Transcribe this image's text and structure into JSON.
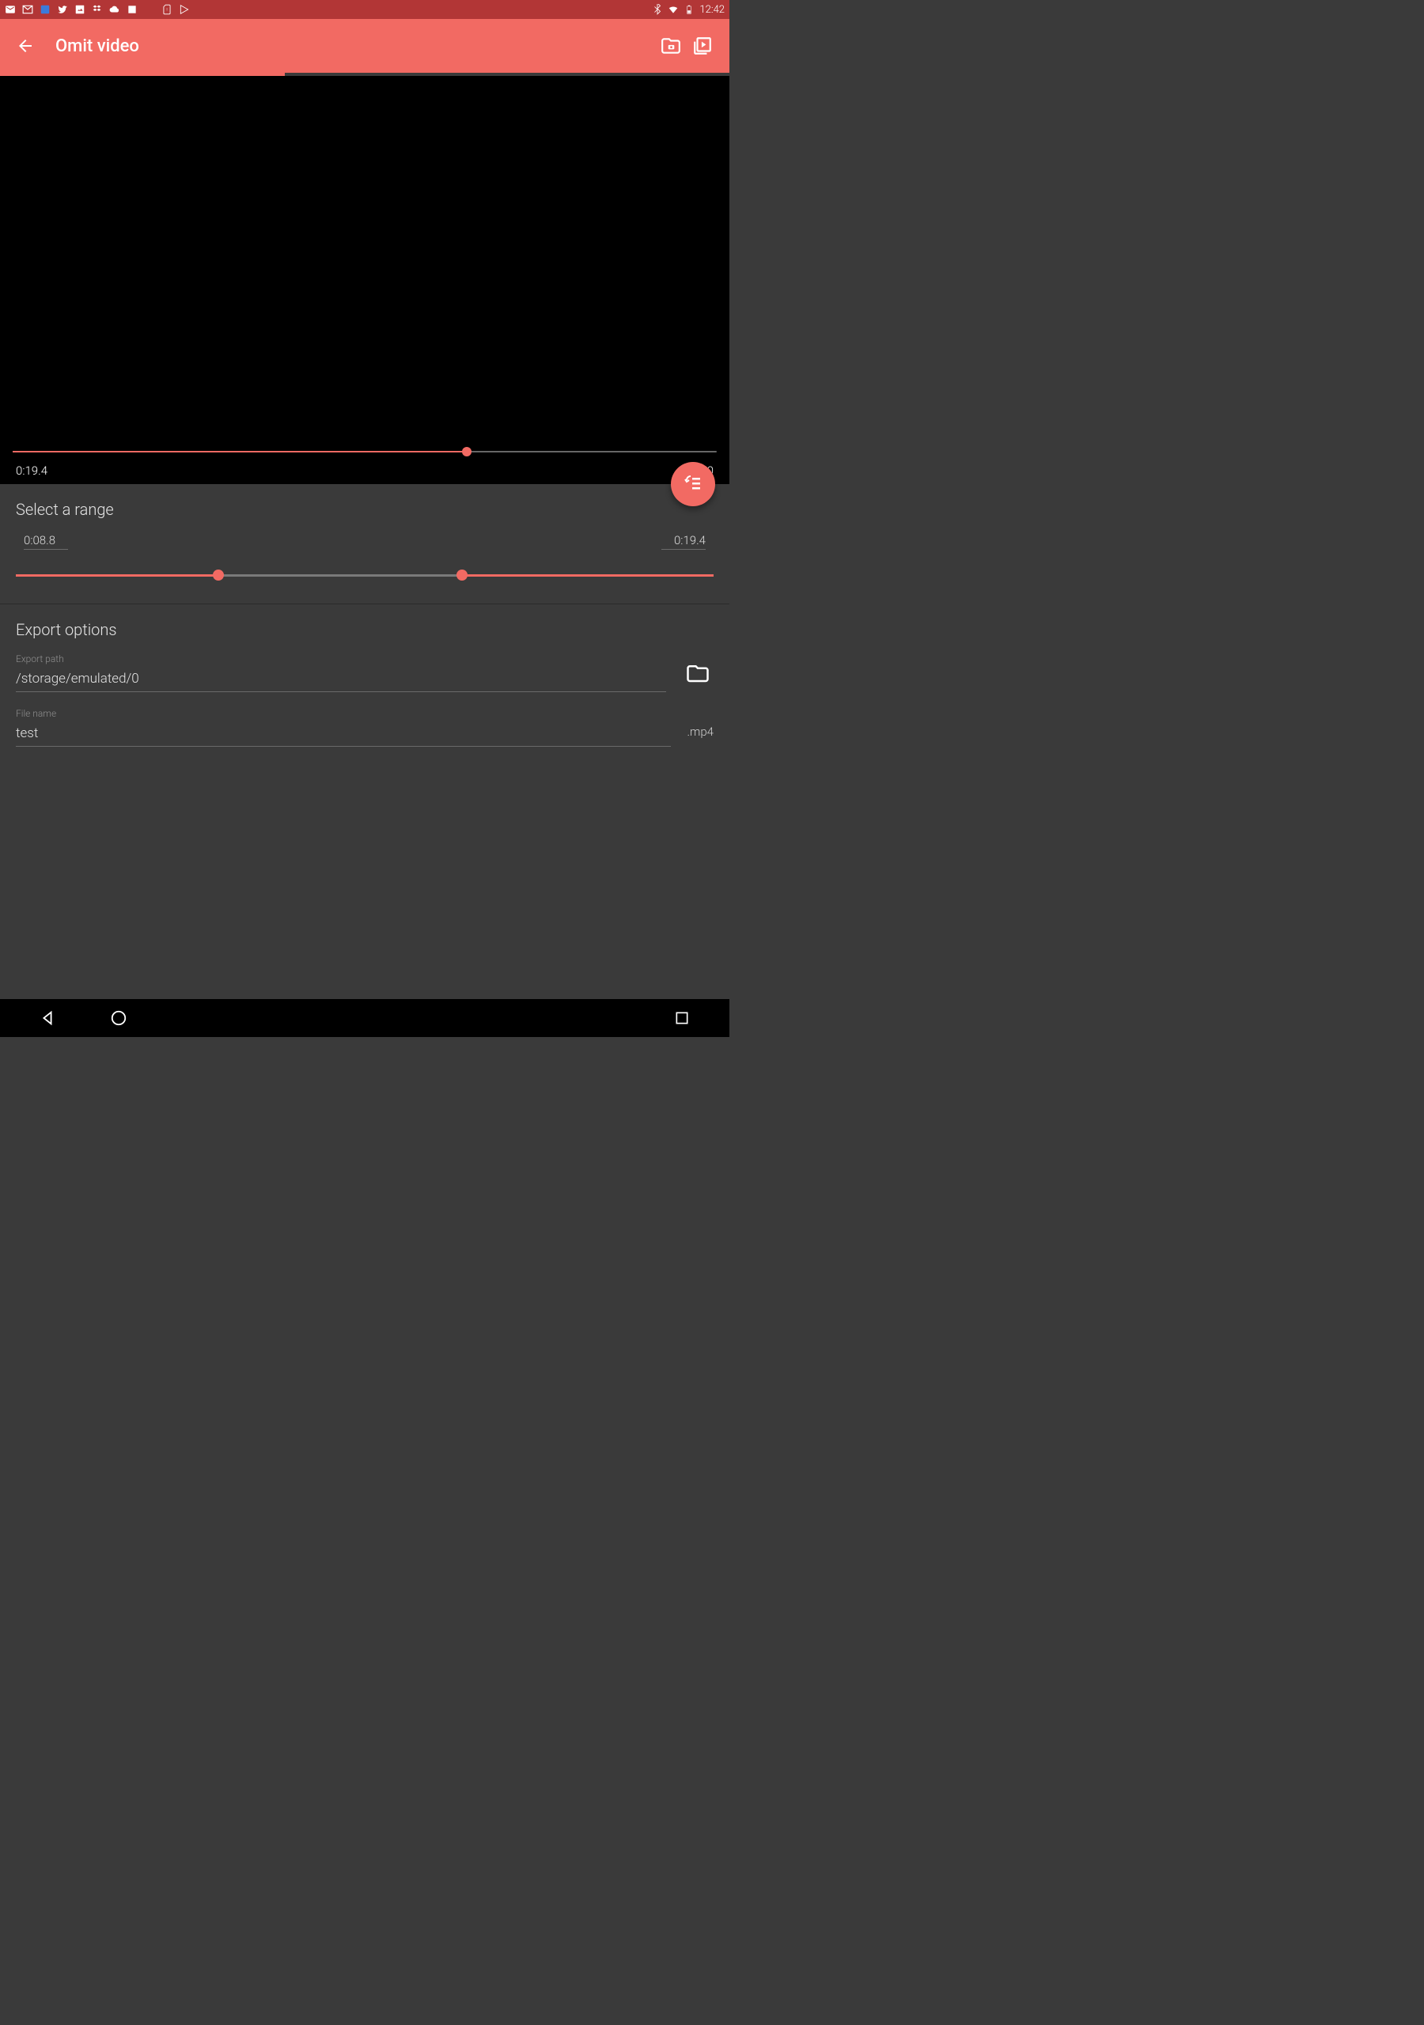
{
  "status": {
    "clock": "12:42"
  },
  "appbar": {
    "title": "Omit video"
  },
  "video": {
    "current_time": "0:19.4",
    "total_time": "0:30.0",
    "progress_pct": 64.5
  },
  "range": {
    "title": "Select a range",
    "start": "0:08.8",
    "end": "0:19.4",
    "start_pct": 29,
    "end_pct": 64
  },
  "export": {
    "title": "Export options",
    "path_label": "Export path",
    "path_value": "/storage/emulated/0",
    "filename_label": "File name",
    "filename_value": "test",
    "extension": ".mp4"
  }
}
